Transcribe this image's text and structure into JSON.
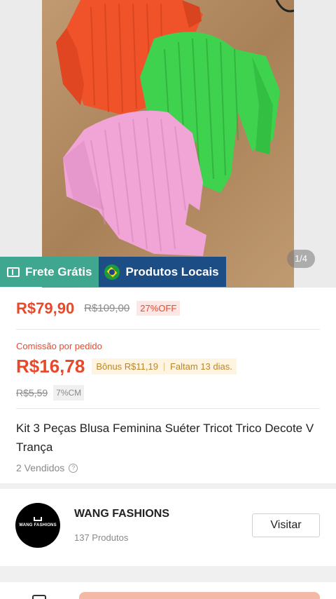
{
  "gallery": {
    "counter": "1/4",
    "badges": {
      "frete": "Frete Grátis",
      "local": "Produtos Locais"
    }
  },
  "price": {
    "current": "R$79,90",
    "original": "R$109,00",
    "discount": "27%OFF"
  },
  "commission": {
    "label": "Comissão por pedido",
    "amount": "R$16,78",
    "bonus": "Bônus R$11,19",
    "remaining": "Faltam 13 dias.",
    "old_amount": "R$5,59",
    "cm_badge": "7%CM"
  },
  "product": {
    "title": "Kit 3 Peças Blusa Feminina Suéter Tricot Trico Decote V Trança",
    "sold": "2 Vendidos",
    "help_glyph": "?"
  },
  "shop": {
    "name": "WANG FASHIONS",
    "logo_text": "WANG FASHIONS",
    "products": "137 Produtos",
    "visit_label": "Visitar"
  },
  "colors": {
    "accent": "#e8492a",
    "frete_badge": "#3fa68f",
    "local_badge": "#1d4d85",
    "sweater_orange": "#f0532a",
    "sweater_green": "#3fd24f",
    "sweater_pink": "#f0a5d6"
  }
}
